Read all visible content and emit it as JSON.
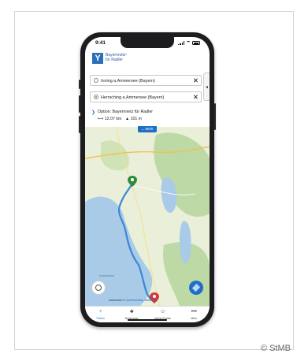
{
  "phone": {
    "status": {
      "time": "9:41"
    },
    "app": {
      "logo_letter": "Y",
      "logo_line1": "Bayernnetz¹",
      "logo_line2": "für Radler"
    },
    "route": {
      "start": "Inning a.Ammersee (Bayern)",
      "end": "Herrsching a.Ammersee (Bayern)",
      "clear_icon": "✕",
      "option_title": "Option: Bayernnetz für Radler",
      "distance": "12.07 km",
      "elevation": "101 m",
      "more_label": "Mehr"
    },
    "map": {
      "attribution_prefix": "Kartendaten ©",
      "attribution_link": "OpenStreetMap-Mitwirkende",
      "lake_label": "Ammersee"
    },
    "tabbar": [
      {
        "label": "Planen",
        "icon": "bike-icon",
        "glyph": "♆",
        "active": true
      },
      {
        "label": "Bayernnetz",
        "icon": "route-icon",
        "glyph": "♣",
        "active": false
      },
      {
        "label": "Meine Routen",
        "icon": "person-icon",
        "glyph": "☺",
        "active": false
      },
      {
        "label": "Mehr",
        "icon": "more-icon",
        "glyph": "•••",
        "active": false
      }
    ]
  },
  "copyright": "© StMB",
  "colors": {
    "accent": "#1f6fc8",
    "route": "#3b86d6",
    "water": "#a9cbe8",
    "land": "#e9efd8",
    "forest": "#bcd9a6",
    "start_pin": "#2e8b3a",
    "end_pin": "#d43a3a"
  }
}
